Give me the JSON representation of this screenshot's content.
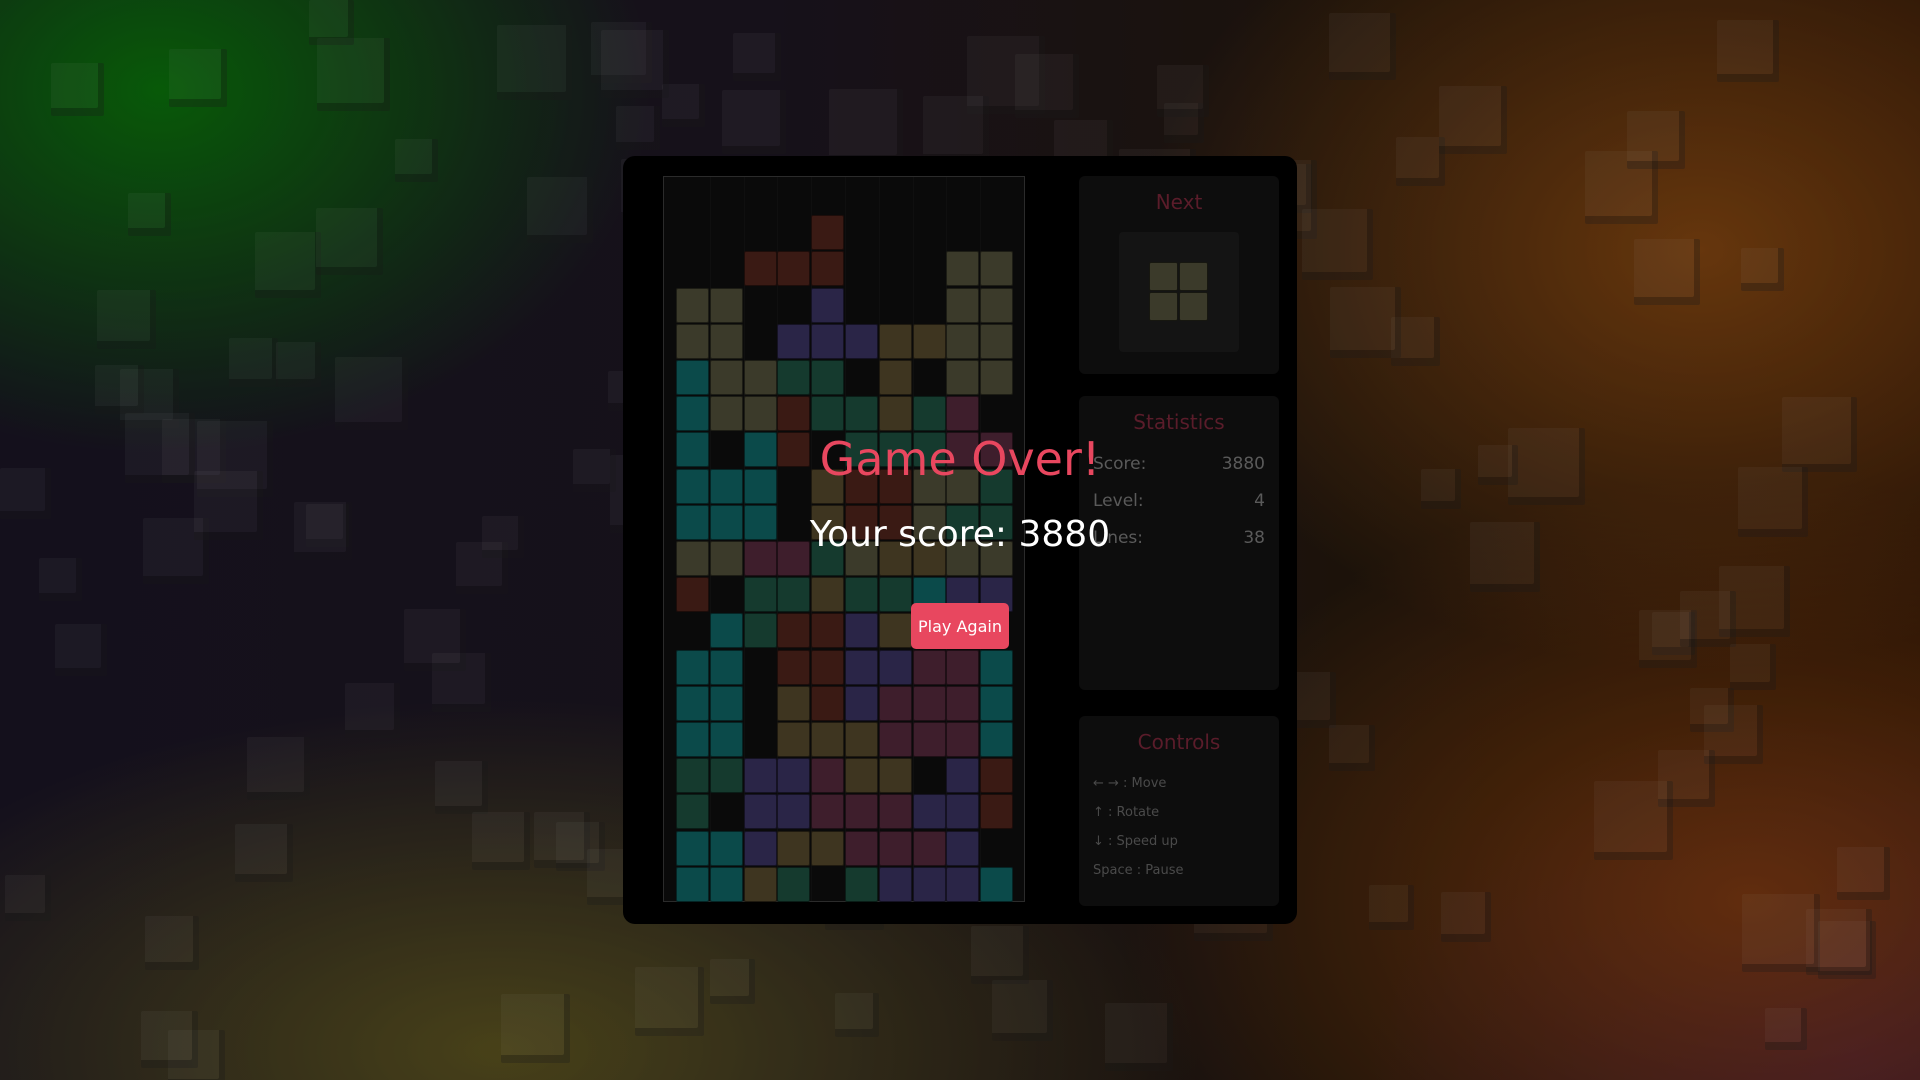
{
  "colors": {
    "accent": "#e8475f",
    "board_bg": "#0a0a0a",
    "panel_bg": "#0d0d0d",
    "piece_colors": {
      "O": "#3b3a2a",
      "I": "#0b4a4a",
      "T": "#2a2547",
      "S": "#153a2e",
      "Z": "#3a1a14",
      "L": "#3e3520",
      "J": "#3a1a2e",
      "P": "#3e1e2c"
    }
  },
  "board": {
    "columns": 10,
    "rows": 20,
    "cells": [
      "..........",
      "....Z.....",
      "..ZZZ...OO",
      "OO..T...OO",
      "OO.TTTLLOO",
      "IOOSS.L.OO",
      "IOOZSSLSP.",
      "I.IZ.SSSPP",
      "III.LZZOOS",
      "III.LZZOSS",
      "OOPPSOLLOO",
      "Z.SSLSSITT",
      ".ISZZTLI..",
      "II.ZZTTPPI",
      "II.LZTPPPI",
      "II.LLLPPPI",
      "SSTTPLL.TZ",
      "S.TTPPPTTZ",
      "IITLLPPPT.",
      "IILS.STTTI"
    ]
  },
  "next": {
    "title": "Next",
    "piece": "O"
  },
  "statistics": {
    "title": "Statistics",
    "score_label": "Score:",
    "score_value": "3880",
    "level_label": "Level:",
    "level_value": "4",
    "lines_label": "Lines:",
    "lines_value": "38"
  },
  "controls": {
    "title": "Controls",
    "items": [
      "← → : Move",
      "↑ : Rotate",
      "↓ : Speed up",
      "Space : Pause"
    ]
  },
  "game_over": {
    "title": "Game Over!",
    "score_text": "Your score: 3880",
    "button_label": "Play Again"
  }
}
